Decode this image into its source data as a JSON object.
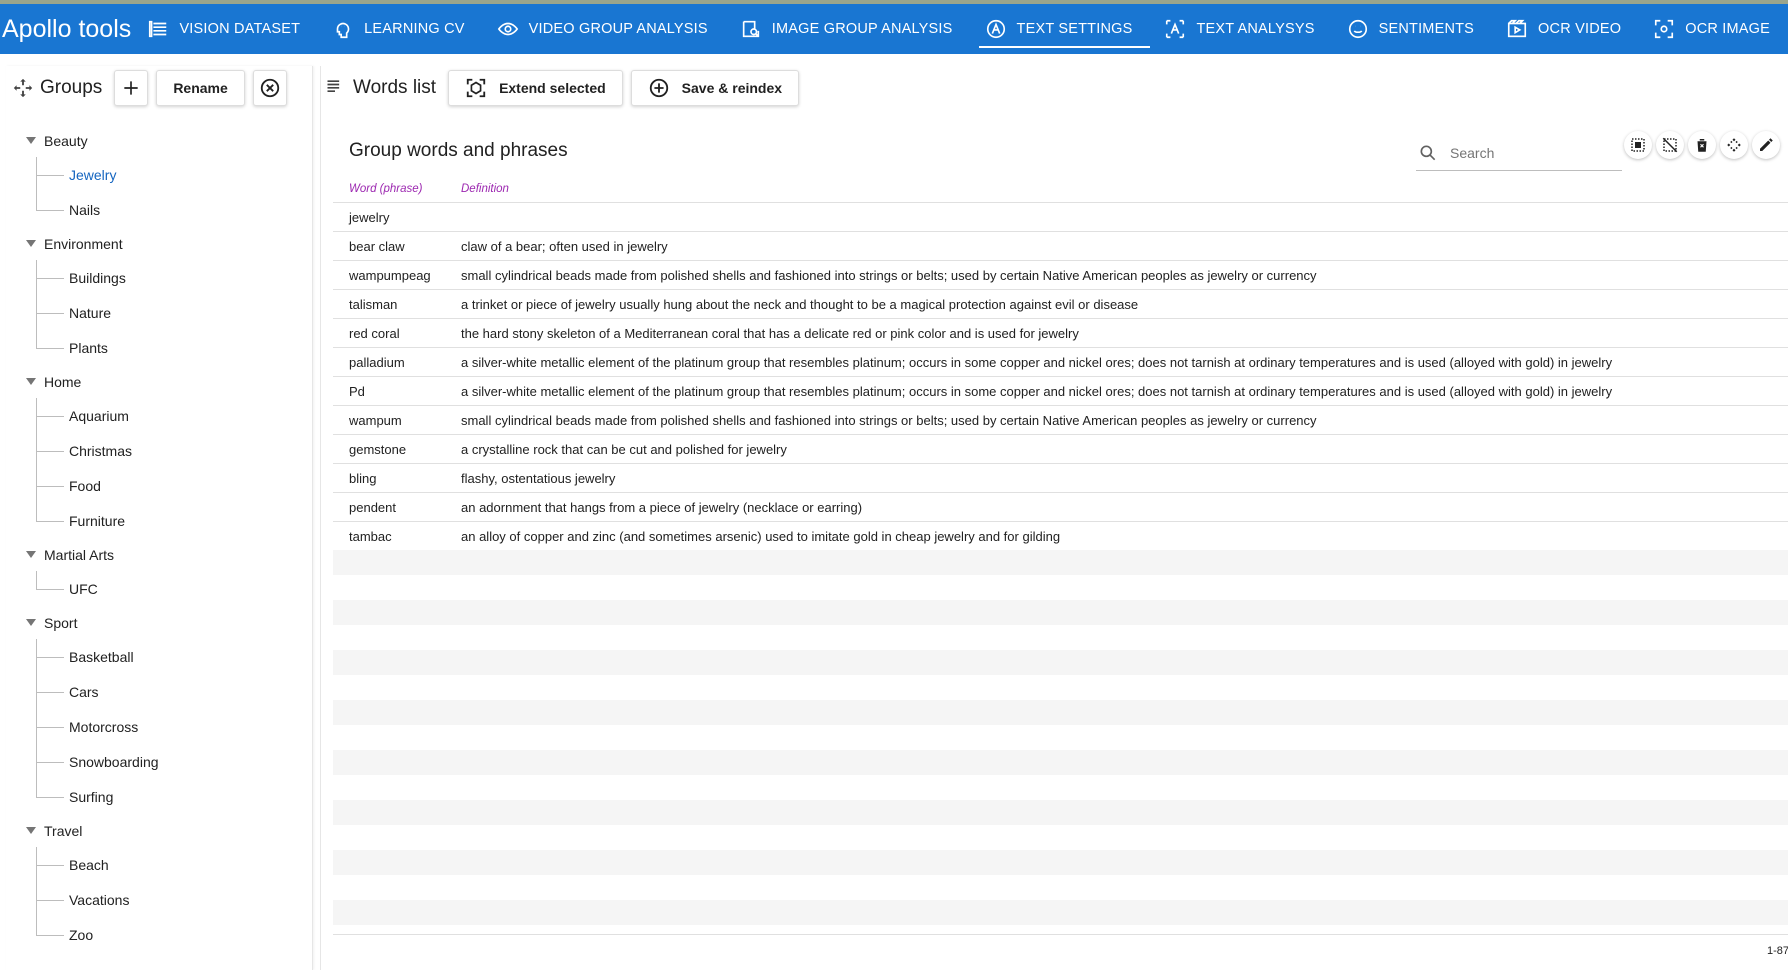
{
  "app": {
    "title": "Apollo tools",
    "accent_color": "#1976d2"
  },
  "nav": [
    {
      "label": "VISION DATASET",
      "icon": "dataset-icon"
    },
    {
      "label": "LEARNING CV",
      "icon": "brain-icon"
    },
    {
      "label": "VIDEO GROUP ANALYSIS",
      "icon": "eye-icon"
    },
    {
      "label": "IMAGE GROUP ANALYSIS",
      "icon": "image-search-icon"
    },
    {
      "label": "TEXT SETTINGS",
      "icon": "text-settings-icon",
      "active": true
    },
    {
      "label": "TEXT ANALYSYS",
      "icon": "text-analysis-icon"
    },
    {
      "label": "SENTIMENTS",
      "icon": "smiley-icon"
    },
    {
      "label": "OCR VIDEO",
      "icon": "video-icon"
    },
    {
      "label": "OCR IMAGE",
      "icon": "ocr-image-icon"
    }
  ],
  "groups_panel": {
    "title": "Groups",
    "add_icon": "plus-icon",
    "rename_label": "Rename",
    "delete_icon": "close-circle-icon",
    "tree": [
      {
        "label": "Beauty",
        "children": [
          "Jewelry",
          "Nails"
        ]
      },
      {
        "label": "Environment",
        "children": [
          "Buildings",
          "Nature",
          "Plants"
        ]
      },
      {
        "label": "Home",
        "children": [
          "Aquarium",
          "Christmas",
          "Food",
          "Furniture"
        ]
      },
      {
        "label": "Martial Arts",
        "children": [
          "UFC"
        ]
      },
      {
        "label": "Sport",
        "children": [
          "Basketball",
          "Cars",
          "Motorcross",
          "Snowboarding",
          "Surfing"
        ]
      },
      {
        "label": "Travel",
        "children": [
          "Beach",
          "Vacations",
          "Zoo"
        ]
      }
    ],
    "selected": "Jewelry"
  },
  "words_panel": {
    "title": "Words list",
    "extend_label": "Extend selected",
    "save_label": "Save & reindex",
    "section_title": "Group words and phrases",
    "search_placeholder": "Search",
    "columns": [
      "Word (phrase)",
      "Definition"
    ],
    "rows": [
      [
        "jewelry",
        ""
      ],
      [
        "bear claw",
        "claw of a bear; often used in jewelry"
      ],
      [
        "wampumpeag",
        "small cylindrical beads made from polished shells and fashioned into strings or belts; used by certain Native American peoples as jewelry or currency"
      ],
      [
        "talisman",
        "a trinket or piece of jewelry usually hung about the neck and thought to be a magical protection against evil or disease"
      ],
      [
        "red coral",
        "the hard stony skeleton of a Mediterranean coral that has a delicate red or pink color and is used for jewelry"
      ],
      [
        "palladium",
        "a silver-white metallic element of the platinum group that resembles platinum; occurs in some copper and nickel ores; does not tarnish at ordinary temperatures and is used (alloyed with gold) in jewelry"
      ],
      [
        "Pd",
        "a silver-white metallic element of the platinum group that resembles platinum; occurs in some copper and nickel ores; does not tarnish at ordinary temperatures and is used (alloyed with gold) in jewelry"
      ],
      [
        "wampum",
        "small cylindrical beads made from polished shells and fashioned into strings or belts; used by certain Native American peoples as jewelry or currency"
      ],
      [
        "gemstone",
        "a crystalline rock that can be cut and polished for jewelry"
      ],
      [
        "bling",
        "flashy, ostentatious jewelry"
      ],
      [
        "pendent",
        "an adornment that hangs from a piece of jewelry (necklace or earring)"
      ],
      [
        "tambac",
        "an alloy of copper and zinc (and sometimes arsenic) used to imitate gold in cheap jewelry and for gilding"
      ]
    ],
    "pagination": "1-87",
    "column_header_color": "#9c27b0"
  }
}
